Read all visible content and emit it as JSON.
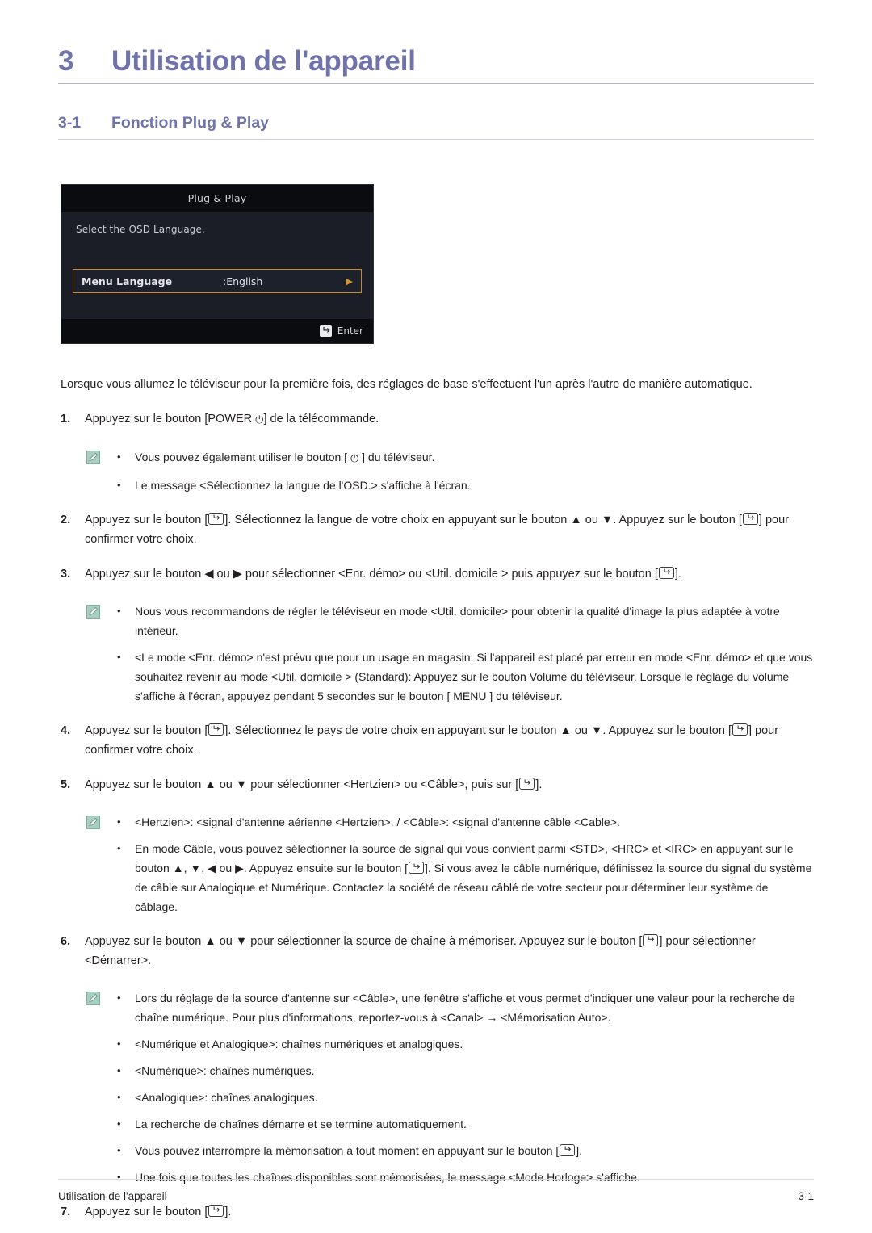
{
  "chapter": {
    "number": "3",
    "title": "Utilisation de l'appareil"
  },
  "section": {
    "number": "3-1",
    "title": "Fonction Plug & Play"
  },
  "osd": {
    "title": "Plug & Play",
    "instruction": "Select the OSD Language.",
    "row_label": "Menu Language",
    "row_value": ":English",
    "row_arrow": "▶",
    "enter_label": "Enter",
    "colors": {
      "background": "#13151c",
      "title_bar": "#0b0c10",
      "panel": "#1b1e27",
      "highlight_border": "#c08b3c"
    }
  },
  "intro": "Lorsque vous allumez le téléviseur pour la première fois, des réglages de base s'effectuent l'un après l'autre de manière automatique.",
  "steps": [
    {
      "number": "1.",
      "parts": [
        {
          "t": "text",
          "v": "Appuyez sur le bouton [POWER "
        },
        {
          "t": "power-icon",
          "v": "⏻"
        },
        {
          "t": "text",
          "v": "] de la télécommande."
        }
      ]
    },
    {
      "number": "2.",
      "parts": [
        {
          "t": "text",
          "v": "Appuyez sur le bouton ["
        },
        {
          "t": "enter-icon",
          "v": "enter-key"
        },
        {
          "t": "text",
          "v": "]. Sélectionnez la langue de votre choix en appuyant sur le bouton ▲ ou ▼. Appuyez sur le bouton ["
        },
        {
          "t": "enter-icon",
          "v": "enter-key"
        },
        {
          "t": "text",
          "v": "] pour confirmer votre choix."
        }
      ]
    },
    {
      "number": "3.",
      "parts": [
        {
          "t": "text",
          "v": "Appuyez sur le bouton ◀ ou ▶ pour sélectionner <Enr. démo> ou <Util. domicile > puis appuyez sur le bouton ["
        },
        {
          "t": "enter-icon",
          "v": "enter-key"
        },
        {
          "t": "text",
          "v": "]."
        }
      ]
    },
    {
      "number": "4.",
      "parts": [
        {
          "t": "text",
          "v": "Appuyez sur le bouton ["
        },
        {
          "t": "enter-icon",
          "v": "enter-key"
        },
        {
          "t": "text",
          "v": "]. Sélectionnez le pays de votre choix en appuyant sur le bouton ▲ ou ▼. Appuyez sur le bouton ["
        },
        {
          "t": "enter-icon",
          "v": "enter-key"
        },
        {
          "t": "text",
          "v": "] pour confirmer votre choix."
        }
      ]
    },
    {
      "number": "5.",
      "parts": [
        {
          "t": "text",
          "v": "Appuyez sur le bouton ▲ ou ▼ pour sélectionner <Hertzien> ou <Câble>, puis sur ["
        },
        {
          "t": "enter-icon",
          "v": "enter-key"
        },
        {
          "t": "text",
          "v": "]."
        }
      ]
    },
    {
      "number": "6.",
      "parts": [
        {
          "t": "text",
          "v": "Appuyez sur le bouton ▲ ou ▼ pour sélectionner la source de chaîne à mémoriser. Appuyez sur le bouton ["
        },
        {
          "t": "enter-icon",
          "v": "enter-key"
        },
        {
          "t": "text",
          "v": "] pour sélectionner <Démarrer>."
        }
      ]
    },
    {
      "number": "7.",
      "parts": [
        {
          "t": "text",
          "v": "Appuyez sur le bouton ["
        },
        {
          "t": "enter-icon",
          "v": "enter-key"
        },
        {
          "t": "text",
          "v": "]."
        }
      ]
    }
  ],
  "notes": [
    {
      "id": "note-after-step-1",
      "icon": "note-pencil-icon",
      "bullet": "•",
      "items": [
        {
          "parts": [
            {
              "t": "text",
              "v": "Vous pouvez également utiliser le bouton [ "
            },
            {
              "t": "power-icon",
              "v": "⏻"
            },
            {
              "t": "text",
              "v": " ] du téléviseur."
            }
          ]
        },
        {
          "parts": [
            {
              "t": "text",
              "v": "Le message <Sélectionnez la langue de l'OSD.> s'affiche à l'écran."
            }
          ]
        }
      ]
    },
    {
      "id": "note-after-step-3",
      "icon": "note-pencil-icon",
      "bullet": "•",
      "items": [
        {
          "parts": [
            {
              "t": "text",
              "v": "Nous vous recommandons de régler le téléviseur en mode <Util. domicile> pour obtenir la qualité d'image la plus adaptée à votre intérieur."
            }
          ]
        },
        {
          "parts": [
            {
              "t": "text",
              "v": "<Le mode <Enr. démo> n'est prévu que pour un usage en magasin. Si l'appareil est placé par erreur en mode <Enr. démo> et que vous souhaitez revenir au mode <Util. domicile > (Standard): Appuyez sur le bouton Volume du téléviseur. Lorsque le réglage du volume s'affiche à l'écran, appuyez pendant 5 secondes sur le bouton [ MENU ] du téléviseur."
            }
          ]
        }
      ]
    },
    {
      "id": "note-after-step-5",
      "icon": "note-pencil-icon",
      "bullet": "•",
      "items": [
        {
          "parts": [
            {
              "t": "text",
              "v": "<Hertzien>: <signal d'antenne aérienne <Hertzien>. / <Câble>: <signal d'antenne câble <Cable>."
            }
          ]
        },
        {
          "parts": [
            {
              "t": "text",
              "v": "En mode Câble, vous pouvez sélectionner la source de signal qui vous convient parmi <STD>, <HRC> et <IRC> en appuyant sur le bouton ▲, ▼, ◀ ou ▶. Appuyez ensuite sur le bouton ["
            },
            {
              "t": "enter-icon",
              "v": "enter-key"
            },
            {
              "t": "text",
              "v": "]. Si vous avez le câble numérique, définissez la source du signal du système de câble sur Analogique et Numérique. Contactez la société de réseau câblé de votre secteur pour déterminer leur système de câblage."
            }
          ]
        }
      ]
    },
    {
      "id": "note-after-step-6",
      "icon": "note-pencil-icon",
      "bullet": "•",
      "items": [
        {
          "parts": [
            {
              "t": "text",
              "v": "Lors du réglage de la source d'antenne sur <Câble>, une fenêtre s'affiche et vous permet d'indiquer une valeur pour la recherche de chaîne numérique. Pour plus d'informations, reportez-vous à <Canal> → <Mémorisation Auto>."
            }
          ]
        },
        {
          "parts": [
            {
              "t": "text",
              "v": "<Numérique et Analogique>: chaînes numériques et analogiques."
            }
          ]
        },
        {
          "parts": [
            {
              "t": "text",
              "v": "<Numérique>: chaînes numériques."
            }
          ]
        },
        {
          "parts": [
            {
              "t": "text",
              "v": "<Analogique>: chaînes analogiques."
            }
          ]
        },
        {
          "parts": [
            {
              "t": "text",
              "v": "La recherche de chaînes démarre et se termine automatiquement."
            }
          ]
        },
        {
          "parts": [
            {
              "t": "text",
              "v": "Vous pouvez interrompre la mémorisation à tout moment en appuyant sur le bouton ["
            },
            {
              "t": "enter-icon",
              "v": "enter-key"
            },
            {
              "t": "text",
              "v": "]."
            }
          ]
        },
        {
          "parts": [
            {
              "t": "text",
              "v": "Une fois que toutes les chaînes disponibles sont mémorisées, le message <Mode Horloge> s'affiche."
            }
          ]
        }
      ]
    }
  ],
  "footer": {
    "left": "Utilisation de l'appareil",
    "right": "3-1"
  },
  "theme": {
    "heading_color": "#6f73aa",
    "heading_rule_color": "#aeb0d0",
    "text_color": "#231f20",
    "note_icon_color": "#8bbfae"
  }
}
